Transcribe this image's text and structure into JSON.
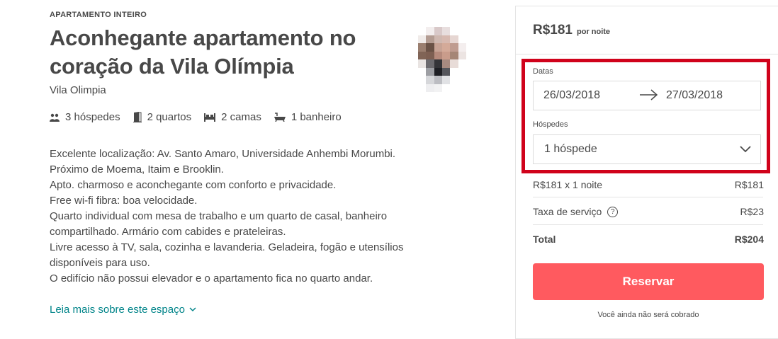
{
  "listing": {
    "type_label": "APARTAMENTO INTEIRO",
    "title_line1": "Aconhegante apartamento no",
    "title_line2": "coração da Vila Olímpia",
    "location": "Vila Olimpia",
    "amenities": [
      {
        "icon": "guests-icon",
        "label": "3 hóspedes"
      },
      {
        "icon": "door-icon",
        "label": "2 quartos"
      },
      {
        "icon": "bed-icon",
        "label": "2 camas"
      },
      {
        "icon": "bathtub-icon",
        "label": "1 banheiro"
      }
    ],
    "description_lines": [
      "Excelente localização: Av. Santo Amaro, Universidade Anhembi Morumbi.",
      "Próximo de Moema, Itaim e Brooklin.",
      "Apto. charmoso e aconchegante com conforto e privacidade.",
      "Free wi-fi fibra: boa velocidade.",
      "Quarto individual com mesa de trabalho e um quarto de casal, banheiro",
      "compartilhado. Armário com cabides e prateleiras.",
      "Livre acesso à TV, sala, cozinha e lavanderia. Geladeira, fogão e utensílios",
      "disponíveis para uso.",
      "O edifício não possui elevador e o apartamento fica no quarto andar."
    ],
    "read_more": "Leia mais sobre este espaço"
  },
  "booking": {
    "price": "R$181",
    "price_unit": "por noite",
    "dates_label": "Datas",
    "check_in": "26/03/2018",
    "check_out": "27/03/2018",
    "guests_label": "Hóspedes",
    "guests_value": "1 hóspede",
    "line_nightly": {
      "label": "R$181 x 1 noite",
      "value": "R$181"
    },
    "line_service": {
      "label": "Taxa de serviço",
      "help": "?",
      "value": "R$23"
    },
    "line_total": {
      "label": "Total",
      "value": "R$204"
    },
    "reserve_label": "Reservar",
    "note": "Você ainda não será cobrado"
  },
  "colors": {
    "text": "#484848",
    "link": "#008489",
    "reserve_button": "#ff5a5f",
    "highlight_border": "#d0021b",
    "border": "#e4e4e4"
  }
}
